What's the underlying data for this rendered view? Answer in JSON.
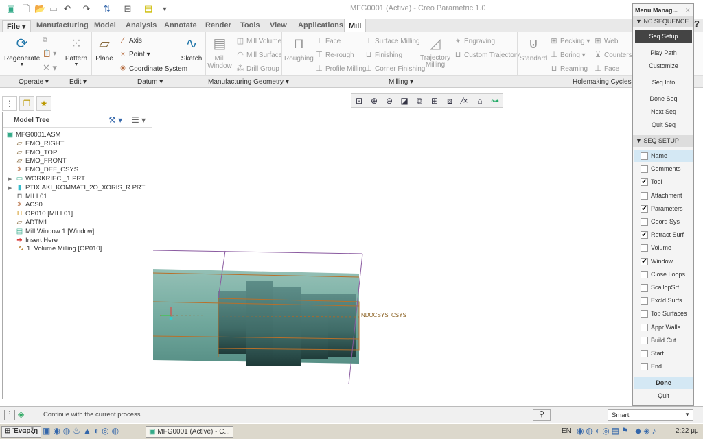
{
  "window": {
    "title": "MFG0001 (Active) - Creo Parametric 1.0"
  },
  "quick_access": [
    "app-icon",
    "new-icon",
    "open-icon",
    "save-icon",
    "undo-icon",
    "redo-icon",
    "regenerate-icon",
    "windows-icon",
    "close-window-icon",
    "customize-icon"
  ],
  "tabs": {
    "file": "File",
    "items": [
      "Manufacturing",
      "Model",
      "Analysis",
      "Annotate",
      "Render",
      "Tools",
      "View",
      "Applications"
    ],
    "active": "Mill"
  },
  "ribbon": {
    "operate": {
      "regenerate": "Regenerate"
    },
    "edit": {
      "pattern": "Pattern"
    },
    "datum": {
      "plane": "Plane",
      "axis": "Axis",
      "point": "Point",
      "csys": "Coordinate System",
      "sketch": "Sketch"
    },
    "mfg_geom": {
      "mill_window": "Mill Window",
      "mill_volume": "Mill Volume",
      "mill_surface": "Mill Surface",
      "drill_group": "Drill Group"
    },
    "milling": {
      "roughing": "Roughing",
      "face": "Face",
      "rerough": "Re-rough",
      "profile": "Profile Milling",
      "surface": "Surface Milling",
      "finishing": "Finishing",
      "corner": "Corner Finishing",
      "trajectory": "Trajectory Milling",
      "engraving": "Engraving",
      "custom": "Custom Trajectory"
    },
    "holemaking": {
      "standard": "Standard",
      "pecking": "Pecking",
      "boring": "Boring",
      "reaming": "Reaming",
      "web": "Web",
      "countersink": "Countersin",
      "face": "Face"
    },
    "groups": [
      "Operate",
      "Edit",
      "Datum",
      "Manufacturing Geometry",
      "Milling",
      "Holemaking Cycles"
    ]
  },
  "model_tree": {
    "title": "Model Tree",
    "nodes": [
      {
        "label": "MFG0001.ASM",
        "icon": "assembly-icon"
      },
      {
        "label": "EMO_RIGHT",
        "icon": "datum-plane-icon"
      },
      {
        "label": "EMO_TOP",
        "icon": "datum-plane-icon"
      },
      {
        "label": "EMO_FRONT",
        "icon": "datum-plane-icon"
      },
      {
        "label": "EMO_DEF_CSYS",
        "icon": "csys-icon"
      },
      {
        "label": "WORKRIECI_1.PRT",
        "icon": "workpiece-icon"
      },
      {
        "label": "PTIXIAKI_KOMMATI_2O_XORIS_R.PRT",
        "icon": "part-icon"
      },
      {
        "label": "MILL01",
        "icon": "workcell-icon"
      },
      {
        "label": "ACS0",
        "icon": "csys-icon"
      },
      {
        "label": "OP010 [MILL01]",
        "icon": "operation-icon"
      },
      {
        "label": "ADTM1",
        "icon": "datum-plane-icon"
      },
      {
        "label": "Mill Window 1 [Window]",
        "icon": "mill-window-icon"
      },
      {
        "label": "Insert Here",
        "icon": "insert-arrow-icon"
      },
      {
        "label": "1. Volume Milling [OP010]",
        "icon": "nc-sequence-icon"
      }
    ]
  },
  "viewport": {
    "csys_label": "NDOCSYS_CSYS"
  },
  "menu_manager": {
    "title": "Menu Manag...",
    "nc_sequence": {
      "header": "NC SEQUENCE",
      "items": [
        "Seq Setup",
        "Play Path",
        "Customize",
        "Seq Info",
        "Done Seq",
        "Next Seq",
        "Quit Seq"
      ],
      "selected": "Seq Setup"
    },
    "seq_setup": {
      "header": "SEQ SETUP",
      "items": [
        {
          "label": "Name",
          "checked": false
        },
        {
          "label": "Comments",
          "checked": false
        },
        {
          "label": "Tool",
          "checked": true
        },
        {
          "label": "Attachment",
          "checked": false
        },
        {
          "label": "Parameters",
          "checked": true
        },
        {
          "label": "Coord Sys",
          "checked": false
        },
        {
          "label": "Retract Surf",
          "checked": true
        },
        {
          "label": "Volume",
          "checked": false
        },
        {
          "label": "Window",
          "checked": true
        },
        {
          "label": "Close Loops",
          "checked": false
        },
        {
          "label": "ScallopSrf",
          "checked": false
        },
        {
          "label": "Excld Surfs",
          "checked": false
        },
        {
          "label": "Top Surfaces",
          "checked": false
        },
        {
          "label": "Appr Walls",
          "checked": false
        },
        {
          "label": "Build Cut",
          "checked": false
        },
        {
          "label": "Start",
          "checked": false
        },
        {
          "label": "End",
          "checked": false
        }
      ]
    },
    "done": "Done",
    "quit": "Quit"
  },
  "status": {
    "message": "Continue with the current process.",
    "filter": "Smart"
  },
  "taskbar": {
    "start": "Έναρξη",
    "window": "MFG0001 (Active) - C...",
    "lang": "EN",
    "time": "2:22 μμ"
  }
}
